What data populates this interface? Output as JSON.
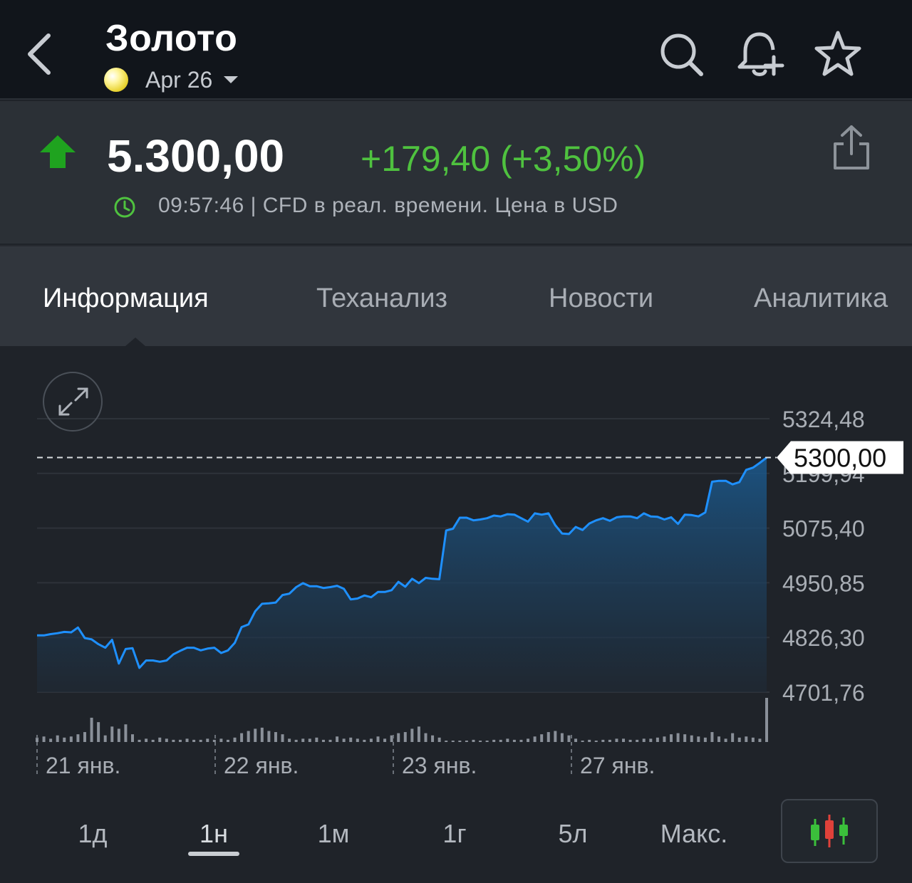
{
  "header": {
    "title": "Золото",
    "contract": "Apr 26"
  },
  "quote": {
    "price": "5.300,00",
    "change": "+179,40 (+3,50%)",
    "meta": "09:57:46 | CFD в реал. времени. Цена в USD",
    "colors": {
      "up": "#1fa31f",
      "change_text": "#4fc23f"
    }
  },
  "tabs": [
    {
      "label": "Информация",
      "active": true
    },
    {
      "label": "Теханализ",
      "active": false
    },
    {
      "label": "Новости",
      "active": false
    },
    {
      "label": "Аналитика",
      "active": false
    }
  ],
  "chart_data": {
    "type": "area",
    "current_label": "5300,00",
    "ylim": [
      4701.76,
      5324.48
    ],
    "y_ticks": [
      "5324,48",
      "5199,94",
      "5075,40",
      "4950,85",
      "4826,30",
      "4701,76"
    ],
    "x_labels": [
      "21 янв.",
      "22 янв.",
      "23 янв.",
      "27 янв."
    ],
    "series": [
      {
        "color": "#1e90ff",
        "values": [
          4831,
          4831,
          4834,
          4836,
          4839,
          4838,
          4849,
          4825,
          4822,
          4811,
          4803,
          4821,
          4767,
          4800,
          4802,
          4757,
          4774,
          4774,
          4771,
          4774,
          4788,
          4796,
          4803,
          4803,
          4797,
          4801,
          4803,
          4791,
          4797,
          4814,
          4850,
          4856,
          4886,
          4903,
          4904,
          4906,
          4923,
          4926,
          4941,
          4950,
          4943,
          4943,
          4939,
          4941,
          4944,
          4937,
          4913,
          4915,
          4922,
          4918,
          4930,
          4930,
          4934,
          4953,
          4942,
          4960,
          4950,
          4962,
          4960,
          4959,
          5070,
          5074,
          5099,
          5099,
          5093,
          5095,
          5098,
          5104,
          5102,
          5107,
          5106,
          5098,
          5090,
          5109,
          5106,
          5109,
          5082,
          5063,
          5062,
          5078,
          5071,
          5086,
          5093,
          5098,
          5092,
          5100,
          5102,
          5102,
          5098,
          5109,
          5102,
          5101,
          5095,
          5100,
          5085,
          5106,
          5105,
          5102,
          5111,
          5181,
          5183,
          5183,
          5175,
          5180,
          5208,
          5213,
          5224,
          5236
        ]
      }
    ],
    "volume": [
      4,
      5,
      3,
      6,
      4,
      5,
      7,
      9,
      22,
      18,
      6,
      14,
      12,
      16,
      7,
      2,
      3,
      2,
      4,
      3,
      2,
      2,
      3,
      2,
      2,
      3,
      2,
      3,
      2,
      4,
      8,
      10,
      12,
      13,
      10,
      9,
      7,
      3,
      2,
      3,
      3,
      4,
      2,
      2,
      5,
      3,
      4,
      3,
      2,
      3,
      5,
      3,
      6,
      8,
      9,
      12,
      14,
      8,
      6,
      4,
      1,
      1,
      1,
      1,
      2,
      1,
      1,
      2,
      2,
      3,
      2,
      2,
      3,
      5,
      7,
      9,
      10,
      8,
      6,
      3,
      1,
      2,
      1,
      2,
      2,
      3,
      3,
      2,
      2,
      3,
      3,
      4,
      5,
      7,
      8,
      7,
      6,
      5,
      4,
      9,
      5,
      3,
      8,
      4,
      5,
      4,
      3,
      40
    ]
  },
  "ranges": [
    {
      "label": "1д",
      "active": false
    },
    {
      "label": "1н",
      "active": true
    },
    {
      "label": "1м",
      "active": false
    },
    {
      "label": "1г",
      "active": false
    },
    {
      "label": "5л",
      "active": false
    },
    {
      "label": "Макс.",
      "active": false
    }
  ]
}
